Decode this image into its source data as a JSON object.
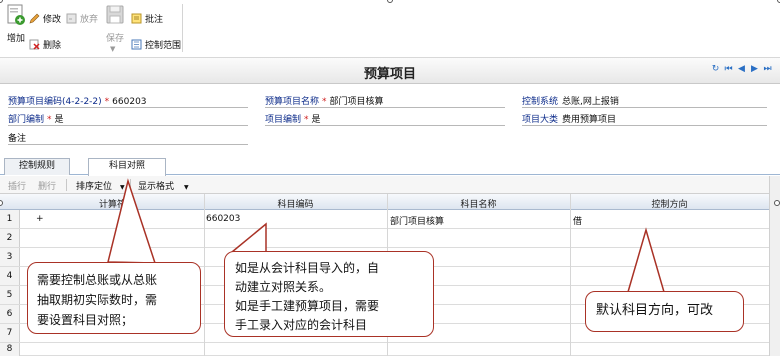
{
  "toolbar": {
    "add_label": "增加",
    "edit_label": "修改",
    "abandon_label": "放弃",
    "delete_label": "删除",
    "save_label": "保存",
    "approve_label": "批注",
    "control_scope_label": "控制范围"
  },
  "window": {
    "title": "预算项目"
  },
  "form": {
    "code_label": "预算项目编码(4-2-2-2)",
    "code_value": "660203",
    "name_label": "预算项目名称",
    "name_value": "部门项目核算",
    "system_label": "控制系统",
    "system_value": "总账,网上报销",
    "dept_label": "部门编制",
    "dept_value": "是",
    "project_label": "项目编制",
    "project_value": "是",
    "category_label": "项目大类",
    "category_value": "费用预算项目",
    "remark_label": "备注"
  },
  "tabs": [
    {
      "label": "控制规则"
    },
    {
      "label": "科目对照"
    }
  ],
  "grid_toolbar": {
    "insert_label": "插行",
    "delete_label": "删行",
    "sort_label": "排序定位",
    "display_label": "显示格式"
  },
  "table": {
    "columns": [
      "计算符",
      "科目编码",
      "科目名称",
      "控制方向"
    ],
    "rows": [
      {
        "num": "1",
        "operator": "+",
        "code": "660203",
        "name": "部门项目核算",
        "direction": "借"
      },
      {
        "num": "2"
      },
      {
        "num": "3"
      },
      {
        "num": "4"
      },
      {
        "num": "5"
      },
      {
        "num": "6"
      },
      {
        "num": "7"
      },
      {
        "num": "8"
      }
    ]
  },
  "callouts": {
    "left": [
      "需要控制总账或从总账",
      "抽取期初实际数时，需",
      "要设置科目对照；"
    ],
    "middle": [
      "如是从会计科目导入的，自",
      "动建立对照关系。",
      "如是手工建预算项目，需要",
      "手工录入对应的会计科目"
    ],
    "right": [
      "默认科目方向，可改"
    ]
  },
  "colors": {
    "accent": "#2a6fc4",
    "callout_border": "#a93226",
    "required": "#d02020"
  }
}
